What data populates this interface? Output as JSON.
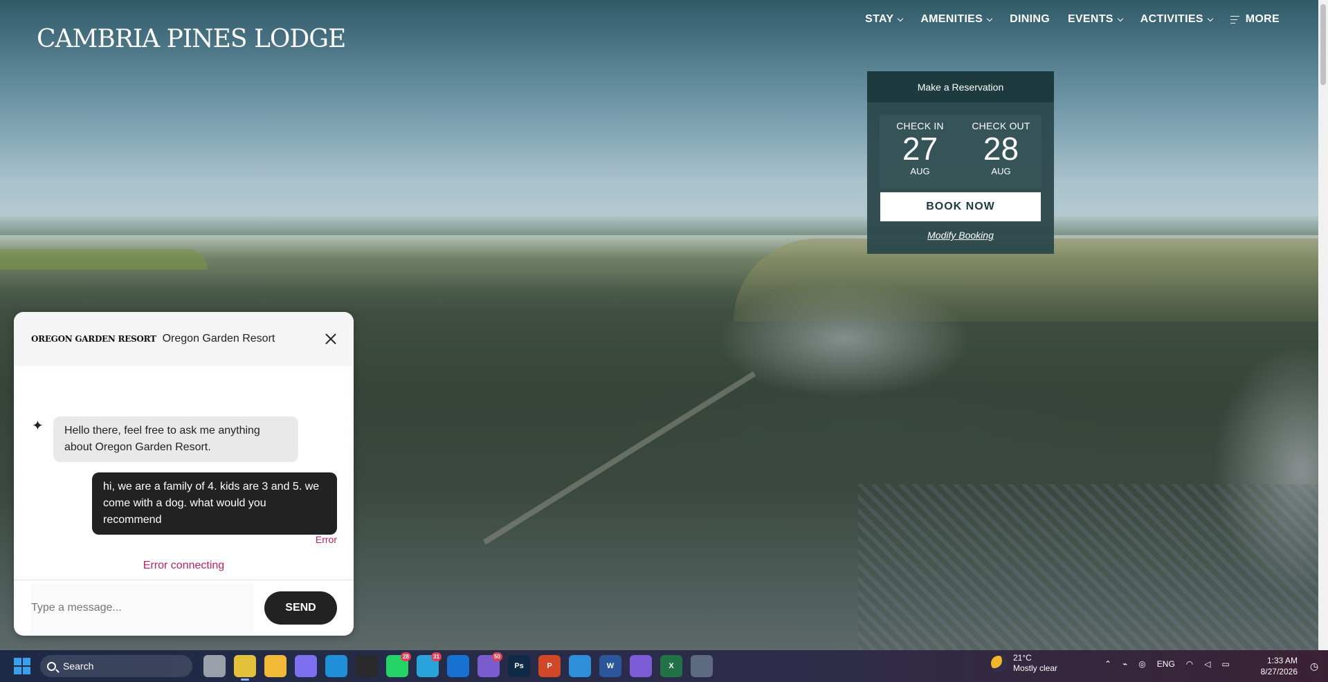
{
  "site": {
    "logo": "CAMBRIA PINES LODGE",
    "nav": [
      {
        "label": "STAY",
        "dropdown": true
      },
      {
        "label": "AMENITIES",
        "dropdown": true
      },
      {
        "label": "DINING",
        "dropdown": false
      },
      {
        "label": "EVENTS",
        "dropdown": true
      },
      {
        "label": "ACTIVITIES",
        "dropdown": true
      },
      {
        "label": "MORE",
        "dropdown": false
      }
    ]
  },
  "reservation": {
    "title": "Make a Reservation",
    "checkin_label": "CHECK IN",
    "checkin_day": "27",
    "checkin_month": "AUG",
    "checkout_label": "CHECK OUT",
    "checkout_day": "28",
    "checkout_month": "AUG",
    "book_label": "BOOK NOW",
    "modify_label": "Modify Booking"
  },
  "chat": {
    "logo": "OREGON GARDEN RESORT",
    "title": "Oregon Garden Resort",
    "bot_message": "Hello there, feel free to ask me anything about Oregon Garden Resort.",
    "user_message": "hi, we are a family of 4. kids are 3 and 5. we come with a dog. what would you recommend",
    "message_error": "Error",
    "connection_error": "Error connecting",
    "input_placeholder": "Type a message...",
    "input_value": "",
    "send_label": "SEND"
  },
  "taskbar": {
    "search_label": "Search",
    "apps": [
      {
        "name": "file-explorer-icon",
        "color": "#9aa0a8",
        "label": "",
        "badge": ""
      },
      {
        "name": "chrome-icon",
        "color": "#e3c13a",
        "label": "",
        "badge": "",
        "active": true
      },
      {
        "name": "folder-icon",
        "color": "#f2b836",
        "label": "",
        "badge": ""
      },
      {
        "name": "copilot-icon",
        "color": "#7d6ff0",
        "label": "",
        "badge": ""
      },
      {
        "name": "edge-icon",
        "color": "#1f8fd8",
        "label": "",
        "badge": ""
      },
      {
        "name": "terminal-icon",
        "color": "#2a2a2a",
        "label": "",
        "badge": ""
      },
      {
        "name": "whatsapp-icon",
        "color": "#25d366",
        "label": "",
        "badge": "28"
      },
      {
        "name": "telegram-icon",
        "color": "#2aa3dd",
        "label": "",
        "badge": "31"
      },
      {
        "name": "outlook-icon",
        "color": "#1771d1",
        "label": "",
        "badge": ""
      },
      {
        "name": "viber-icon",
        "color": "#7b5ccf",
        "label": "",
        "badge": "50"
      },
      {
        "name": "photoshop-icon",
        "color": "#0e2a47",
        "label": "Ps",
        "badge": ""
      },
      {
        "name": "powerpoint-icon",
        "color": "#d24726",
        "label": "P",
        "badge": ""
      },
      {
        "name": "notepad-icon",
        "color": "#2d8fd8",
        "label": "",
        "badge": ""
      },
      {
        "name": "word-icon",
        "color": "#2b579a",
        "label": "W",
        "badge": ""
      },
      {
        "name": "obsidian-icon",
        "color": "#7c5bd6",
        "label": "",
        "badge": ""
      },
      {
        "name": "excel-icon",
        "color": "#217346",
        "label": "X",
        "badge": ""
      },
      {
        "name": "calculator-icon",
        "color": "#5c6b80",
        "label": "",
        "badge": ""
      }
    ],
    "weather_temp": "21°C",
    "weather_desc": "Mostly clear",
    "language": "ENG",
    "time": "1:33 AM",
    "date": "8/27/2026"
  }
}
